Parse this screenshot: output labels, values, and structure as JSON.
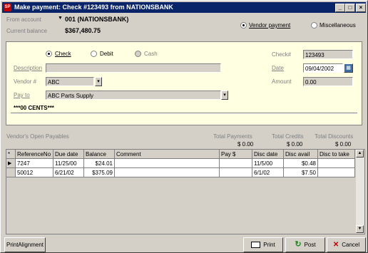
{
  "window": {
    "title": "Make payment: Check #123493 from NATIONSBANK",
    "icon_text": "SP",
    "min_glyph": "_",
    "max_glyph": "□",
    "close_glyph": "×"
  },
  "header": {
    "from_account_label": "From account",
    "from_account_value": "001 (NATIONSBANK)",
    "current_balance_label": "Current balance",
    "current_balance_value": "$367,480.75",
    "payee_type_options": [
      "Vendor payment",
      "Miscellaneous"
    ],
    "payee_type_selected": "Vendor payment"
  },
  "check": {
    "method_options": [
      "Check",
      "Debit",
      "Cash"
    ],
    "method_selected": "Check",
    "check_no_label": "Check#",
    "check_no_value": "123493",
    "date_label": "Date",
    "date_value": "09/04/2002",
    "amount_label": "Amount",
    "amount_value": "0.00",
    "description_label": "Description",
    "description_value": "",
    "vendor_label": "Vendor #",
    "vendor_value": "ABC",
    "pay_to_label": "Pay to",
    "pay_to_value": "ABC Parts Supply",
    "amount_words": "***00 CENTS***"
  },
  "payables": {
    "section_label": "Vendor's Open Payables",
    "total_payments_label": "Total Payments",
    "total_payments_value": "$ 0.00",
    "total_credits_label": "Total Credits",
    "total_credits_value": "$ 0.00",
    "total_discounts_label": "Total Discounts",
    "total_discounts_value": "$ 0.00",
    "columns": [
      "*",
      "ReferenceNo",
      "Due date",
      "Balance",
      "Comment",
      "Pay $",
      "Disc date",
      "Disc avail",
      "Disc to take"
    ],
    "rows": [
      [
        "7247",
        "11/25/00",
        "$24.01",
        "",
        "",
        "11/5/00",
        "$0.48",
        ""
      ],
      [
        "50012",
        "6/21/02",
        "$375.09",
        "",
        "",
        "6/1/02",
        "$7.50",
        ""
      ]
    ],
    "row_marker": "▶"
  },
  "buttons": {
    "print_alignment": "PrintAlignment",
    "print": "Print",
    "post": "Post",
    "cancel": "Cancel"
  },
  "colors": {
    "titlebar": "#0a246a",
    "paper": "#ffffe1",
    "window": "#d4d0c8"
  }
}
